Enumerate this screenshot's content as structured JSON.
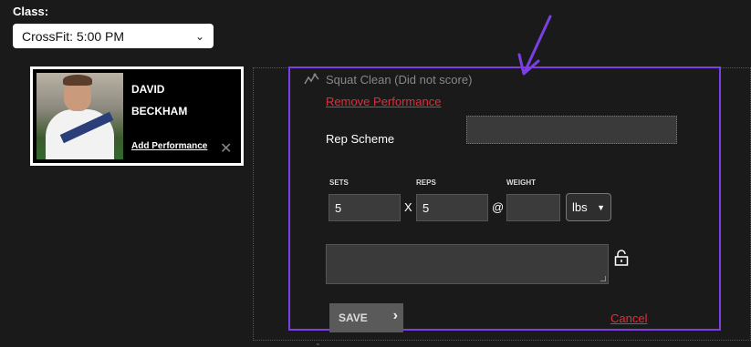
{
  "class_filter": {
    "label": "Class:",
    "selected": "CrossFit: 5:00 PM"
  },
  "athlete": {
    "first_name": "DAVID",
    "last_name": "BECKHAM",
    "add_performance": "Add Performance",
    "close_glyph": "✕"
  },
  "performance": {
    "title": "Squat Clean (Did not score)",
    "remove_label": "Remove Performance",
    "rep_scheme_label": "Rep Scheme",
    "rep_scheme_value": "",
    "sets_label": "SETS",
    "reps_label": "REPS",
    "weight_label": "WEIGHT",
    "sets_value": "5",
    "reps_value": "5",
    "weight_value": "",
    "x_sep": "X",
    "at_sep": "@",
    "unit": "lbs",
    "notes_value": "",
    "save_label": "SAVE",
    "cancel_label": "Cancel"
  },
  "colors": {
    "highlight": "#7b3fe4",
    "link_red": "#e0303a"
  },
  "icons": [
    "wod-trend-icon",
    "lock-open-icon",
    "close-icon",
    "chevron-right-icon",
    "chevron-down-icon"
  ]
}
